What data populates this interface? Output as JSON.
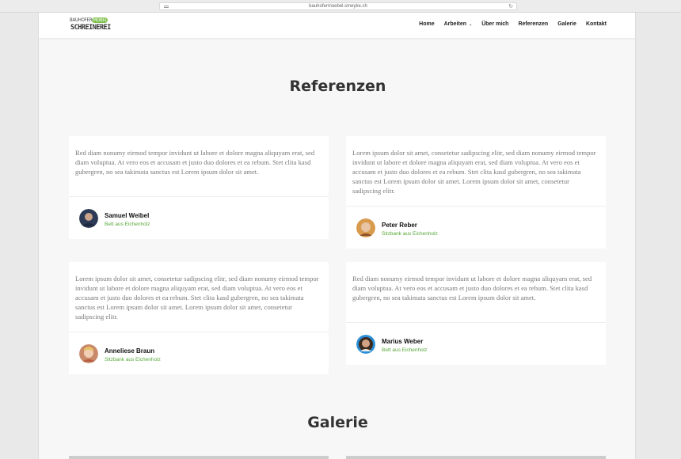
{
  "browser": {
    "url": "bauhofermoebel.smeyke.ch"
  },
  "logo": {
    "top_left": "BAUHOFER",
    "top_badge": "MÖBEL",
    "bottom": "SCHREINEREI"
  },
  "nav": {
    "items": [
      {
        "label": "Home"
      },
      {
        "label": "Arbeiten"
      },
      {
        "label": "Über mich"
      },
      {
        "label": "Referenzen"
      },
      {
        "label": "Galerie"
      },
      {
        "label": "Kontakt"
      }
    ]
  },
  "references": {
    "title": "Referenzen",
    "cards": [
      {
        "text": "Red diam nonumy eirmod tempor invidunt ut labore et dolore magna aliquyam erat, sed diam voluptua. At vero eos et accusam et justo duo dolores et ea rebum. Stet clita kasd gubergren, no sea takimata sanctus est Lorem ipsum dolor sit amet.",
        "name": "Samuel Weibel",
        "role": "Bett aus Eichenholz"
      },
      {
        "text": "Lorem ipsum dolor sit amet, consetetur sadipscing elitr, sed diam nonumy eirmod tempor invidunt ut labore et dolore magna aliquyam erat, sed diam voluptua. At vero eos et accusam et justo duo dolores et ea rebum. Stet clita kasd gubergren, no sea takimata sanctus est Lorem ipsum dolor sit amet. Lorem ipsum dolor sit amet, consetetur sadipscing elitr.",
        "name": "Peter Reber",
        "role": "Sitzbank aus Eichenholz"
      },
      {
        "text": "Lorem ipsum dolor sit amet, consetetur sadipscing elitr, sed diam nonumy eirmod tempor invidunt ut labore et dolore magna aliquyam erat, sed diam voluptua. At vero eos et accusam et justo duo dolores et ea rebum. Stet clita kasd gubergren, no sea takimata sanctus est Lorem ipsum dolor sit amet. Lorem ipsum dolor sit amet, consetetur sadipscing elitr.",
        "name": "Anneliese Braun",
        "role": "Sitzbank aus Eichenholz"
      },
      {
        "text": "Red diam nonumy eirmod tempor invidunt ut labore et dolore magna aliquyam erat, sed diam voluptua. At vero eos et accusam et justo duo dolores et ea rebum. Stet clita kasd gubergren, no sea takimata sanctus est Lorem ipsum dolor sit amet.",
        "name": "Marius Weber",
        "role": "Bett aus Eichenholz"
      }
    ]
  },
  "gallery": {
    "title": "Galerie"
  },
  "colors": {
    "accent_green": "#56a839",
    "logo_green": "#7cbf4a",
    "heading": "#333333",
    "body_text": "#7a7a7a"
  }
}
